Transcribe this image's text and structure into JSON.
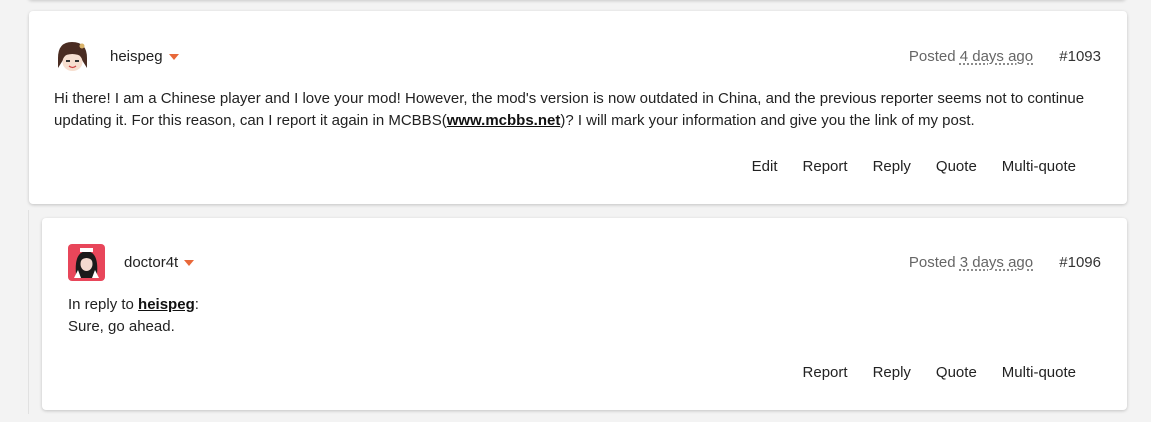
{
  "posts": [
    {
      "author": "heispeg",
      "posted_prefix": "Posted",
      "posted_time": "4 days ago",
      "post_number": "#1093",
      "body_text_before_link": "Hi there! I am a Chinese player and I love your mod! However, the mod's version is now outdated in China, and the previous reporter seems not to continue updating it. For this reason, can I report it again in MCBBS(",
      "body_link": "www.mcbbs.net",
      "body_text_after_link": ")? I will mark your information and give you the link of my post.",
      "actions": [
        "Edit",
        "Report",
        "Reply",
        "Quote",
        "Multi-quote"
      ]
    },
    {
      "author": "doctor4t",
      "posted_prefix": "Posted",
      "posted_time": "3 days ago",
      "post_number": "#1096",
      "reply_prefix": "In reply to ",
      "reply_to": "heispeg",
      "reply_suffix": ":",
      "body_text": "Sure, go ahead.",
      "actions": [
        "Report",
        "Reply",
        "Quote",
        "Multi-quote"
      ]
    }
  ],
  "colors": {
    "accent_caret": "#e8683a",
    "background": "#f3f3f3",
    "card": "#ffffff"
  }
}
